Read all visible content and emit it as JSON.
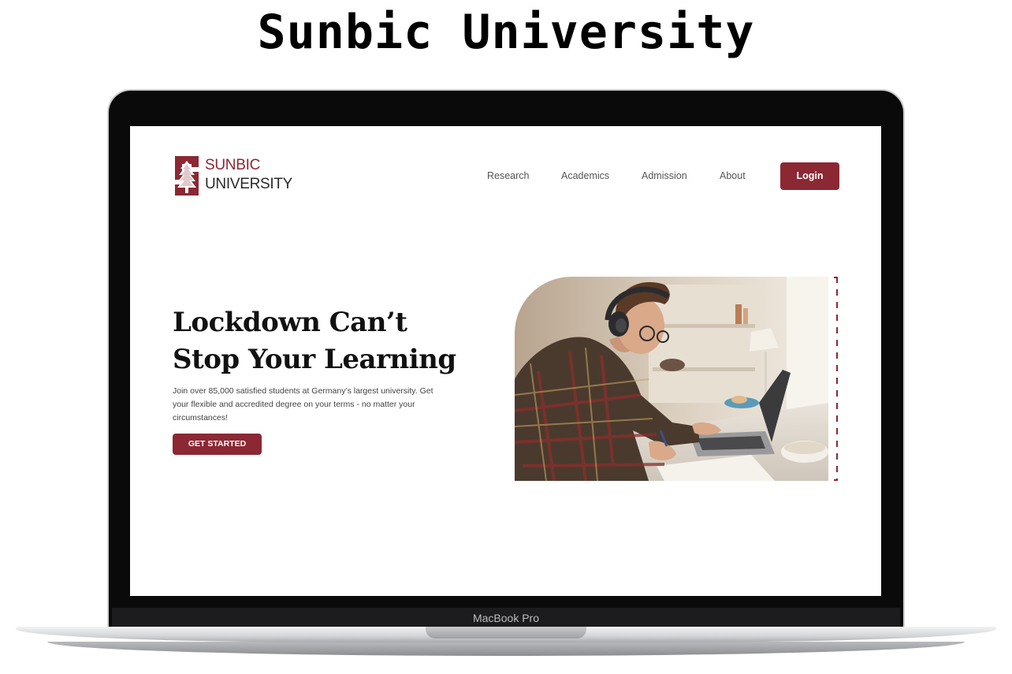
{
  "page": {
    "title": "Sunbic University"
  },
  "device": {
    "label": "MacBook Pro"
  },
  "site": {
    "logo": {
      "line1": "SUNBIC",
      "line2": "UNIVERSITY",
      "icon": "sunbic-s-tree-emblem-icon"
    },
    "nav": {
      "items": [
        "Research",
        "Academics",
        "Admission",
        "About"
      ],
      "login_label": "Login"
    },
    "hero": {
      "title_line1": "Lockdown Can’t",
      "title_line2": "Stop Your Learning",
      "text": "Join over 85,000 satisfied students at Germany’s largest university. Get your flexible and accredited degree on your terms - no matter your circumstances!",
      "cta_label": "GET STARTED",
      "image": "student-with-headphones-studying-at-laptop-photo"
    }
  },
  "colors": {
    "brand": "#8b2833",
    "text": "#111111",
    "muted": "#555555"
  }
}
